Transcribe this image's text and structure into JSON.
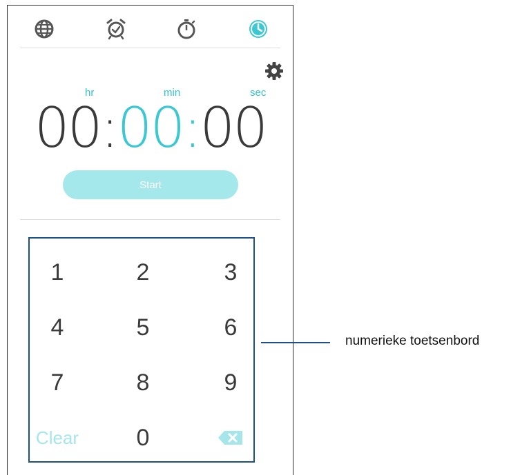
{
  "tabs": [
    {
      "icon": "globe-icon"
    },
    {
      "icon": "alarm-clock-icon"
    },
    {
      "icon": "stopwatch-icon"
    },
    {
      "icon": "timer-icon",
      "active": true
    }
  ],
  "timer": {
    "hr_label": "hr",
    "min_label": "min",
    "sec_label": "sec",
    "hours": "00",
    "minutes": "00",
    "seconds": "00",
    "separator": ":"
  },
  "start_label": "Start",
  "keypad": {
    "keys": [
      "1",
      "2",
      "3",
      "4",
      "5",
      "6",
      "7",
      "8",
      "9"
    ],
    "clear_label": "Clear",
    "zero": "0"
  },
  "callout": "numerieke toetsenbord",
  "colors": {
    "accent": "#3cc8d2",
    "button": "#a4e8ec",
    "frame": "#1e4f8a"
  }
}
